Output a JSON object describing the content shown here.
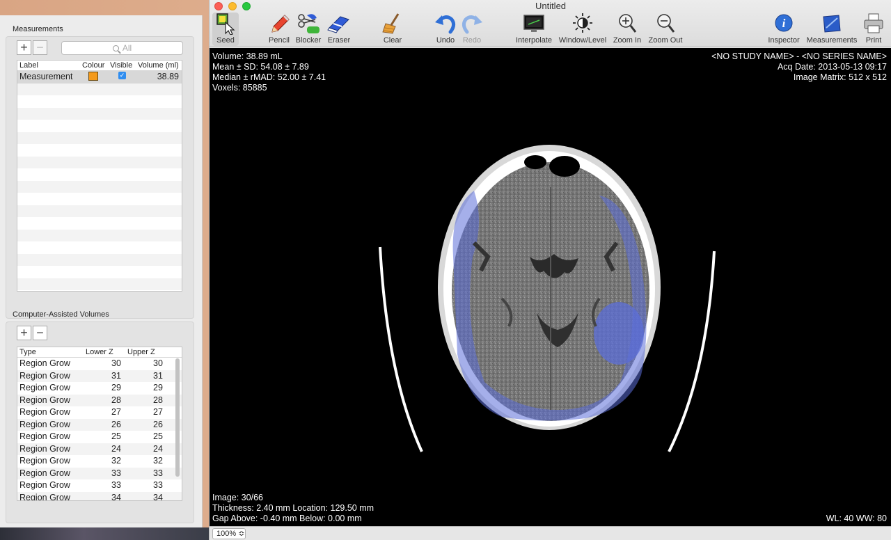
{
  "window": {
    "title": "Untitled"
  },
  "toolbar": [
    {
      "id": "seed",
      "label": "Seed"
    },
    {
      "id": "pencil",
      "label": "Pencil"
    },
    {
      "id": "blocker",
      "label": "Blocker"
    },
    {
      "id": "eraser",
      "label": "Eraser"
    },
    {
      "id": "clear",
      "label": "Clear"
    },
    {
      "id": "undo",
      "label": "Undo"
    },
    {
      "id": "redo",
      "label": "Redo"
    },
    {
      "id": "interpolate",
      "label": "Interpolate"
    },
    {
      "id": "window_level",
      "label": "Window/Level"
    },
    {
      "id": "zoom_in",
      "label": "Zoom In"
    },
    {
      "id": "zoom_out",
      "label": "Zoom Out"
    },
    {
      "id": "inspector",
      "label": "Inspector"
    },
    {
      "id": "measurements",
      "label": "Measurements"
    },
    {
      "id": "print",
      "label": "Print"
    }
  ],
  "measurements": {
    "title": "Measurements",
    "search_placeholder": "All",
    "add": "+",
    "remove": "−",
    "columns": [
      "Label",
      "Colour",
      "Visible",
      "Volume (ml)"
    ],
    "rows": [
      {
        "label": "Measurement",
        "colour": "#f49a1c",
        "visible": true,
        "volume": "38.89"
      }
    ]
  },
  "cav": {
    "title": "Computer-Assisted Volumes",
    "add": "+",
    "remove": "−",
    "columns": [
      "Type",
      "Lower Z",
      "Upper Z"
    ],
    "rows": [
      {
        "type": "Region Grow",
        "lower": "30",
        "upper": "30"
      },
      {
        "type": "Region Grow",
        "lower": "31",
        "upper": "31"
      },
      {
        "type": "Region Grow",
        "lower": "29",
        "upper": "29"
      },
      {
        "type": "Region Grow",
        "lower": "28",
        "upper": "28"
      },
      {
        "type": "Region Grow",
        "lower": "27",
        "upper": "27"
      },
      {
        "type": "Region Grow",
        "lower": "26",
        "upper": "26"
      },
      {
        "type": "Region Grow",
        "lower": "25",
        "upper": "25"
      },
      {
        "type": "Region Grow",
        "lower": "24",
        "upper": "24"
      },
      {
        "type": "Region Grow",
        "lower": "32",
        "upper": "32"
      },
      {
        "type": "Region Grow",
        "lower": "33",
        "upper": "33"
      },
      {
        "type": "Region Grow",
        "lower": "33",
        "upper": "33"
      },
      {
        "type": "Region Grow",
        "lower": "34",
        "upper": "34"
      }
    ]
  },
  "overlay": {
    "top_left": [
      "Volume: 38.89 mL",
      "Mean ± SD: 54.08 ± 7.89",
      "Median ± rMAD: 52.00 ± 7.41",
      "Voxels: 85885"
    ],
    "top_right": [
      "<NO STUDY NAME> - <NO SERIES NAME>",
      "Acq Date: 2013-05-13 09:17",
      "Image Matrix: 512 x 512"
    ],
    "bottom_left": [
      "Image: 30/66",
      "Thickness: 2.40 mm Location: 129.50 mm",
      "Gap Above: -0.40 mm Below: 0.00 mm"
    ],
    "bottom_right": "WL: 40 WW: 80"
  },
  "status": {
    "zoom": "100% ≎"
  },
  "colors": {
    "accent": "#2f8df0",
    "overlay_blue": "#5b6ed8",
    "measurement_colour": "#f49a1c"
  }
}
